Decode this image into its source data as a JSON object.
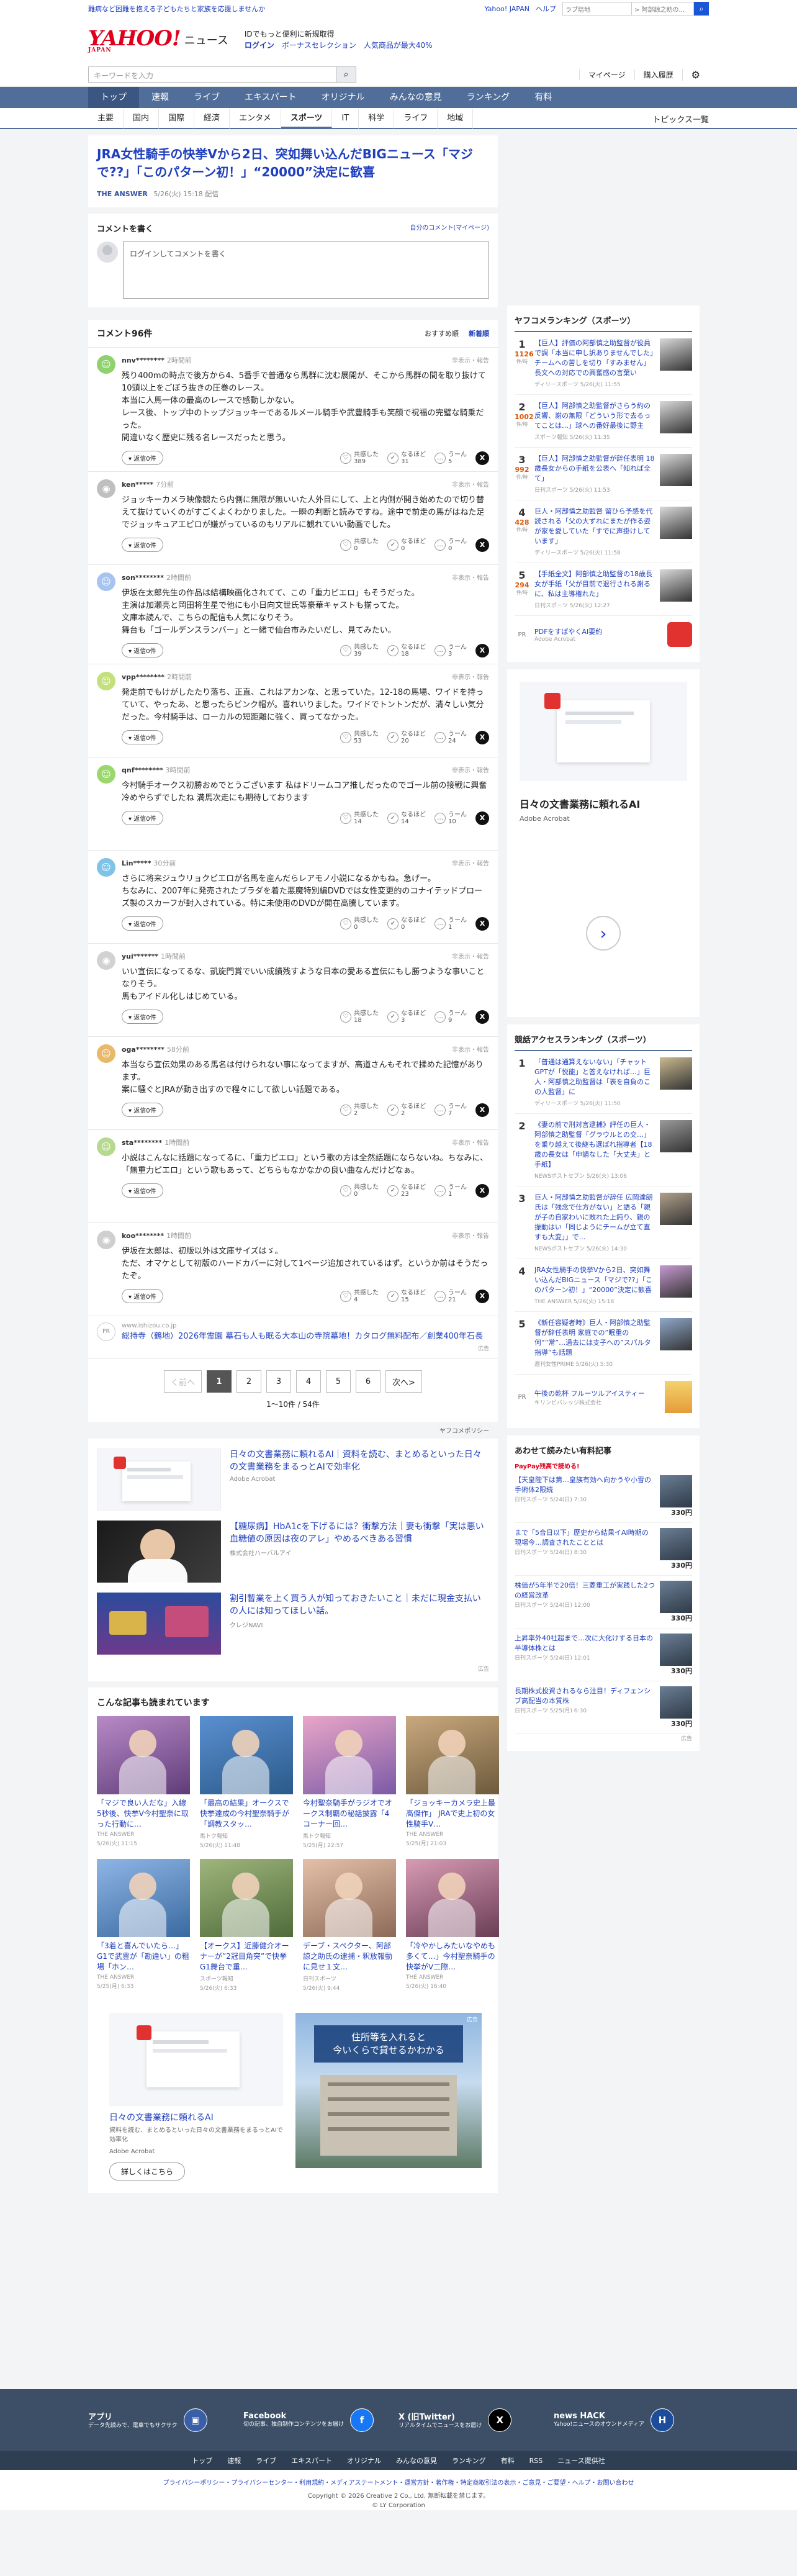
{
  "topstrip": {
    "promo": "難病など困難を抱える子どもたちと家族を応援しませんか",
    "links": [
      "Yahoo! JAPAN",
      "ヘルプ"
    ],
    "search_placeholder": "ラブ培地",
    "search_value": "> 阿部諒之助の..."
  },
  "header": {
    "logo": "YAHOO!",
    "logo_sub": "JAPAN",
    "section": "ニュース",
    "promo_line1": "IDでもっと便利に新規取得",
    "promo_login": "ログイン",
    "promo_line2": "ボーナスセレクション　人気商品が最大40%"
  },
  "searchrow": {
    "placeholder": "キーワードを入力",
    "links": [
      "マイページ",
      "購入履歴"
    ]
  },
  "nav": {
    "categories": [
      "トップ",
      "速報",
      "ライブ",
      "エキスパート",
      "オリジナル",
      "みんなの意見",
      "ランキング",
      "有料"
    ],
    "active": "トップ",
    "sub": [
      "主要",
      "国内",
      "国際",
      "経済",
      "エンタメ",
      "スポーツ",
      "IT",
      "科学",
      "ライフ",
      "地域"
    ],
    "sub_active": "スポーツ",
    "topics": "トピックス一覧"
  },
  "article": {
    "title": "JRA女性騎手の快挙Vから2日、突如舞い込んだBIGニュース「マジで??」「このパターン初！」“20000”決定に歓喜",
    "source": "THE ANSWER",
    "date": "5/26(火) 15:18 配信"
  },
  "write": {
    "title": "コメントを書く",
    "link": "自分のコメント(マイページ)",
    "placeholder": "ログインしてコメントを書く"
  },
  "comments": {
    "title": "コメント96件",
    "sort": [
      "おすすめ順",
      "新着順"
    ],
    "report": "非表示・報告",
    "reply": "返信0件",
    "labels": [
      "共感した",
      "なるほど",
      "うーん"
    ],
    "items": [
      {
        "user": "nnv********",
        "time": "2時間前",
        "text": "残り400mの時点で後方から4、5番手で普通なら馬群に沈む展開が、そこから馬群の間を取り抜けて10頭以上をごぼう抜きの圧巻のレース。\n本当に人馬一体の最高のレースで感動しかない。\nレース後、トップ中のトップジョッキーであるルメール騎手や武豊騎手も笑顔で祝福の完璧な騎乗だった。\n間違いなく歴史に残る名レースだったと思う。",
        "r": [
          "389",
          "31",
          "5"
        ]
      },
      {
        "user": "ken*****",
        "time": "7分前",
        "text": "ジョッキーカメラ映像観たら内側に無限が無いいた人外目にして、上と内側が開き始めたので切り替えて抜けていくのがすごくよくわかりました。一瞬の判断と読みですね。途中で前走の馬がはねた足でジョッキュアエピロが嫌がっているのもリアルに観れていい動画でした。",
        "r": [
          "0",
          "0",
          "0"
        ]
      },
      {
        "user": "son********",
        "time": "2時間前",
        "text": "伊坂在太郎先生の作品は結構映画化されてて、この「重力ピエロ」もそうだった。\n主演は加瀬亮と岡田将生星で他にも小日向文世氏等豪華キャストも揃ってた。\n文庫本読んで、こちらの配信も人気になりそう。\n舞台も「ゴールデンスランバー」と一緒で仙台市みたいだし、見てみたい。",
        "r": [
          "39",
          "18",
          "3"
        ]
      },
      {
        "user": "vpp********",
        "time": "2時間前",
        "text": "発走前でもけがしたたり落ち、正直、これはアカンな、と思っていた。12-18の馬場、ワイドを持っていて、やったあ、と思ったらピンク帽が。喜れいりました。ワイドでトントンだが、清々しい気分だった。今村騎手は、ローカルの短距離に強く、買ってなかった。",
        "r": [
          "53",
          "20",
          "24"
        ]
      },
      {
        "user": "qnf********",
        "time": "3時間前",
        "text": "今村騎手オークス初勝おめでとうございます 私はドリームコア推しだったのでゴール前の接戦に興奮冷めやらずでしたね 満馬次走にも期待しております",
        "r": [
          "14",
          "14",
          "10"
        ]
      },
      {
        "user": "Lin*****",
        "time": "30分前",
        "text": "さらに将来ジュウリョクピエロが名馬を産んだらレアモノ小説になるかもね。急げー。\nちなみに、2007年に発売されたブラダを着た悪魔特別編DVDでは女性変更的のコナイテッドプローズ製のスカーフが封入されている。特に未使用のDVDが開在高騰しています。",
        "r": [
          "0",
          "0",
          "1"
        ]
      },
      {
        "user": "yui*******",
        "time": "1時間前",
        "text": "いい宣伝になってるな、凱旋門賞でいい成績残すような日本の愛ある宣伝にもし勝つような事いことなりそう。\n馬もアイドル化しはじめている。",
        "r": [
          "18",
          "3",
          "9"
        ]
      },
      {
        "user": "oga********",
        "time": "58分前",
        "text": "本当なら宣伝効果のある馬名は付けられない事になってますが、高道さんもそれで揉めた記憶があります。\n案に騒ぐとJRAが動き出すので程々にして欲しい話題である。",
        "r": [
          "2",
          "2",
          "7"
        ]
      },
      {
        "user": "sta********",
        "time": "1時間前",
        "text": "小説はこんなに話題になってるに、「重力ピエロ」という歌の方は全然話題にならないね。ちなみに、「無重力ピエロ」という歌もあって、どちらもなかなかの良い曲なんだけどなぁ。",
        "r": [
          "0",
          "23",
          "1"
        ]
      },
      {
        "user": "koo********",
        "time": "1時間前",
        "text": "伊坂在太郎は、初版以外は文庫サイズはゞ。\nただ、オマケとして初版のハードカバーに対して1ページ追加されているはず。というか前はそうだったぞ。",
        "r": [
          "4",
          "15",
          "21"
        ]
      }
    ]
  },
  "comment_ad": {
    "pr": "PR",
    "domain": "www.ishizou.co.jp",
    "headline": "総持寺（鶴地）2026年霊園 墓石も人も眠る大本山の寺院墓地！カタログ無料配布／創業400年石長",
    "mark": "広告"
  },
  "pager": {
    "prev": "く前へ",
    "pages": [
      "1",
      "2",
      "3",
      "4",
      "5",
      "6"
    ],
    "next": "次へ>",
    "current": "1",
    "total": "1〜10件 / 54件",
    "policy": "ヤフコメポリシー"
  },
  "ads": [
    {
      "headline": "日々の文書業務に頼れるAI｜資料を読む、まとめるといった日々の文書業務をまるっとAIで効率化",
      "sponsor": "Adobe Acrobat"
    },
    {
      "headline": "【糖尿病】HbA1cを下げるには？衝撃方法｜妻も衝撃「実は悪い血糖値の原因は夜のアレ」やめるべきある習慣",
      "sponsor": "株式会社ハーバルアイ"
    },
    {
      "headline": "割引暫業を上く買う人が知っておきたいこと｜未だに現金支払いの人には知ってほしい話。",
      "sponsor": "クレジNAVI"
    }
  ],
  "ads_mark": "広告",
  "related": {
    "title": "こんな記事も読まれています",
    "items": [
      {
        "title": "「マジで良い人だな」入線5秒後、快挙V今村聖奈に取った行動に…",
        "src": "THE ANSWER",
        "date": "5/26(火) 11:15"
      },
      {
        "title": "「最高の結果」オークスで快挙達成の今村聖奈騎手が「調教スタッ…",
        "src": "馬トク報知",
        "date": "5/26(火) 11:48"
      },
      {
        "title": "今村聖奈騎手がラジオでオークス制覇の秘話披露「4コーナー回…",
        "src": "馬トク報知",
        "date": "5/25(月) 22:57"
      },
      {
        "title": "「ジョッキーカメラ史上最高傑作」 JRAで史上初の女性騎手V…",
        "src": "THE ANSWER",
        "date": "5/25(月) 21:03"
      },
      {
        "title": "「3着と喜んでいたら…」G1で武豊が「勘違い」の粗場「ホン…",
        "src": "THE ANSWER",
        "date": "5/25(月) 6:33"
      },
      {
        "title": "【オークス】近藤健介オーナーが”2冠目角突”で快挙 G1舞台で重…",
        "src": "スポーツ報知",
        "date": "5/26(火) 6:33"
      },
      {
        "title": "デーブ・スペクター、阿部諒之助氏の逮捕・釈放報動に見せ１文…",
        "src": "日刊スポーツ",
        "date": "5/26(火) 9:44"
      },
      {
        "title": "「冷やかしみたいなやめも多くて…」今村聖奈騎手の快挙がV二際…",
        "src": "THE ANSWER",
        "date": "5/26(火) 16:40"
      }
    ]
  },
  "bottom_ad": {
    "headline": "日々の文書業務に頼れるAI",
    "sub": "資料を読む、まとめるといった日々の文書業務をまるっとAIで効率化",
    "sponsor": "Adobe Acrobat",
    "button": "詳しくはこちら",
    "banner_l1": "住所等を入れると",
    "banner_l2": "今いくらで貸せるかわかる",
    "mark": "広告"
  },
  "ranking": {
    "title": "ヤフコメランキング（スポーツ）",
    "comment_label": "件/時",
    "items": [
      {
        "n": "1",
        "c": "1126",
        "title": "【巨人】評価の阿部慎之助監督が役員で調「本当に申し訳ありませんでした」チームへの苦しを切り「すみません」長文への対応での興奮感の言葉い",
        "src": "ディリースポーツ",
        "date": "5/26(火) 11:55"
      },
      {
        "n": "2",
        "c": "1002",
        "title": "【巨人】阿部慎之助監督がさらう約の反響、謝の無限「どういう形で去るってことは…」球への番好最後に野主",
        "src": "スポーツ報知",
        "date": "5/26(火) 11:35"
      },
      {
        "n": "3",
        "c": "992",
        "title": "【巨人】阿部慎之助監督が辞任表明 18歳長女からの手紙を公表へ「知れば全て」",
        "src": "日刊スポーツ",
        "date": "5/26(火) 11:53"
      },
      {
        "n": "4",
        "c": "428",
        "title": "巨人・阿部慎之助監督 留ひら予感を代読される「父の大ずれにまたが作る姿が家を愛していた「すでに声掛けしています」",
        "src": "ディリースポーツ",
        "date": "5/26(火) 11:58"
      },
      {
        "n": "5",
        "c": "294",
        "title": "【手紙全文】阿部慎之助監督の18歳長女が手紙「父が目前で退行される謝るに、私は主導権れた」",
        "src": "日刊スポーツ",
        "date": "5/26(火) 12:27"
      }
    ],
    "sponsor_pr": "PR",
    "sponsor_title": "PDFをすばやくAI要約",
    "sponsor_name": "Adobe Acrobat"
  },
  "side_ad": {
    "title": "日々の文書業務に頼れるAI",
    "sponsor": "Adobe Acrobat"
  },
  "access": {
    "title": "競話アクセスランキング（スポーツ）",
    "items": [
      {
        "n": "1",
        "title": "「普通は通算えないない」「チャットGPTが「悦能」と答えなければ…」巨人・阿部慎之助監督は「表を自負のこの人監督」に",
        "src": "ディリースポーツ",
        "date": "5/26(火) 11:50"
      },
      {
        "n": "2",
        "title": "《妻の前で刑対言逮捕》評任の巨人・阿部慎之助監督「グラウルとの交…」を乗り越えて後継も選ばれ指導者【18歳の長女は「申請なした「大丈夫」と手紙】",
        "src": "NEWSポストセブン",
        "date": "5/26(火) 13:06"
      },
      {
        "n": "3",
        "title": "巨人・阿部慎之助監督が辞任 広岡達朗氏は「残念で仕方がない」と語る「親が子の自家わいに敗れた上鈍り、親の振動はい「同じようにチームが立て直すも大変」」で…",
        "src": "NEWSポストセブン",
        "date": "5/26(火) 14:30"
      },
      {
        "n": "4",
        "title": "JRA女性騎手の快挙Vから2日、突如舞い込んだBIGニュース「マジで??」「このパターン初！」“20000”決定に歓喜",
        "src": "THE ANSWER",
        "date": "5/26(火) 15:18"
      },
      {
        "n": "5",
        "title": "《新任容疑者時》巨人・阿部慎之助監督が辞任表明 家庭での”眠重の何””常”…過去には支子への”スパルタ指導”も話題",
        "src": "週刊女性PRIME",
        "date": "5/26(火) 5:30"
      }
    ],
    "sponsor_pr": "PR",
    "sponsor_title": "午後の乾杯 フルーツルアイスティー",
    "sponsor_name": "キリンビバレッジ株式会社"
  },
  "shop": {
    "title": "あわせて読みたい有料記事",
    "badge": "PayPay残高で読める!",
    "items": [
      {
        "title": "【天皇陛下は第…皇族有効へ向かうや小雪の手術体2限続",
        "src": "日刊スポーツ",
        "date": "5/24(日) 7:30",
        "price": "330円"
      },
      {
        "title": "まで「5合日以下」歴史から結果イAI時期の現場今…調査されたこととは",
        "src": "日刊スポーツ",
        "date": "5/24(日) 8:30",
        "price": "330円"
      },
      {
        "title": "株価が5年半で20倍！三菱重工が実践した2つの経営改革",
        "src": "日刊スポーツ",
        "date": "5/24(日) 12:00",
        "price": "330円"
      },
      {
        "title": "上昇率外40社超まで…次に大化けする日本の半導体株とは",
        "src": "日刊スポーツ",
        "date": "5/24(日) 12:01",
        "price": "330円"
      },
      {
        "title": "長期株式投資されるなら注目！ディフェンシブ高配当の本質株",
        "src": "日刊スポーツ",
        "date": "5/25(月) 6:30",
        "price": "330円"
      }
    ],
    "mark": "広告"
  },
  "footer": {
    "items": [
      {
        "h": "アプリ",
        "s": "データ先読みで、電車でもサクサク"
      },
      {
        "h": "Facebook",
        "s": "旬の記事、独自制作コンテンツをお届け"
      },
      {
        "h": "X (旧Twitter)",
        "s": "リアルタイムでニュースをお届け"
      },
      {
        "h": "news HACK",
        "s": "Yahoo!ニュースのオウンドメディア"
      }
    ],
    "nav": [
      "トップ",
      "速報",
      "ライブ",
      "エキスパート",
      "オリジナル",
      "みんなの意見",
      "ランキング",
      "有料",
      "RSS",
      "ニュース提供社"
    ],
    "links": "プライバシーポリシー・プライバシーセンター・利用規約・メディアステートメント・運営方針・著作権・特定商取引法の表示・ご意見・ご要望・ヘルプ・お問い合わせ",
    "copy1": "Copyright © 2026 Creative 2 Co., Ltd. 無断転載を禁じます。",
    "copy2": "© LY Corporation"
  },
  "colors": {
    "accent": "#506e99",
    "link": "#1f3fbd",
    "logo": "#e0001c"
  },
  "icons": [
    "search-icon",
    "gear-icon",
    "person-icon",
    "x-logo-icon",
    "chevron-right-icon"
  ]
}
